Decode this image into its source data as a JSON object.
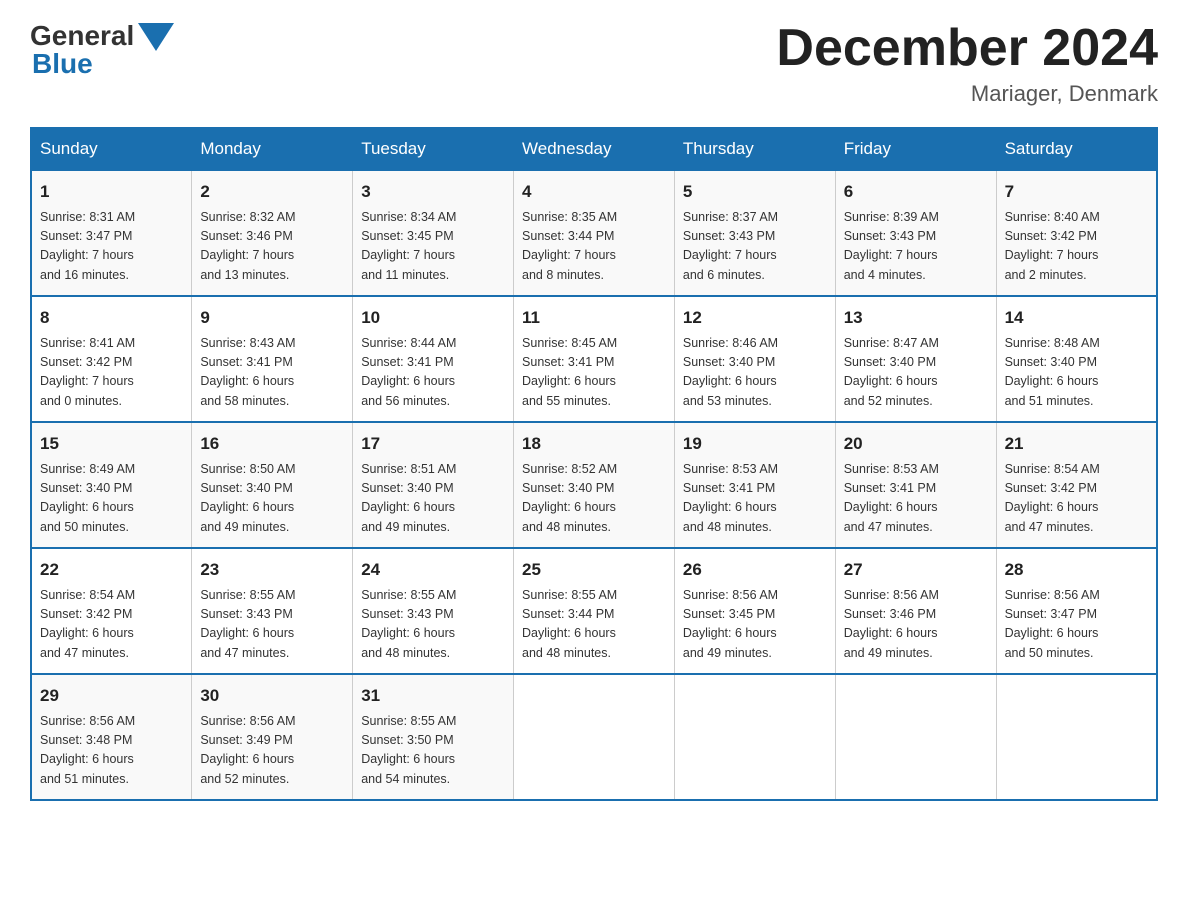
{
  "header": {
    "logo_general": "General",
    "logo_blue": "Blue",
    "month_title": "December 2024",
    "location": "Mariager, Denmark"
  },
  "days_of_week": [
    "Sunday",
    "Monday",
    "Tuesday",
    "Wednesday",
    "Thursday",
    "Friday",
    "Saturday"
  ],
  "weeks": [
    [
      {
        "day": "1",
        "sunrise": "8:31 AM",
        "sunset": "3:47 PM",
        "daylight": "7 hours and 16 minutes."
      },
      {
        "day": "2",
        "sunrise": "8:32 AM",
        "sunset": "3:46 PM",
        "daylight": "7 hours and 13 minutes."
      },
      {
        "day": "3",
        "sunrise": "8:34 AM",
        "sunset": "3:45 PM",
        "daylight": "7 hours and 11 minutes."
      },
      {
        "day": "4",
        "sunrise": "8:35 AM",
        "sunset": "3:44 PM",
        "daylight": "7 hours and 8 minutes."
      },
      {
        "day": "5",
        "sunrise": "8:37 AM",
        "sunset": "3:43 PM",
        "daylight": "7 hours and 6 minutes."
      },
      {
        "day": "6",
        "sunrise": "8:39 AM",
        "sunset": "3:43 PM",
        "daylight": "7 hours and 4 minutes."
      },
      {
        "day": "7",
        "sunrise": "8:40 AM",
        "sunset": "3:42 PM",
        "daylight": "7 hours and 2 minutes."
      }
    ],
    [
      {
        "day": "8",
        "sunrise": "8:41 AM",
        "sunset": "3:42 PM",
        "daylight": "7 hours and 0 minutes."
      },
      {
        "day": "9",
        "sunrise": "8:43 AM",
        "sunset": "3:41 PM",
        "daylight": "6 hours and 58 minutes."
      },
      {
        "day": "10",
        "sunrise": "8:44 AM",
        "sunset": "3:41 PM",
        "daylight": "6 hours and 56 minutes."
      },
      {
        "day": "11",
        "sunrise": "8:45 AM",
        "sunset": "3:41 PM",
        "daylight": "6 hours and 55 minutes."
      },
      {
        "day": "12",
        "sunrise": "8:46 AM",
        "sunset": "3:40 PM",
        "daylight": "6 hours and 53 minutes."
      },
      {
        "day": "13",
        "sunrise": "8:47 AM",
        "sunset": "3:40 PM",
        "daylight": "6 hours and 52 minutes."
      },
      {
        "day": "14",
        "sunrise": "8:48 AM",
        "sunset": "3:40 PM",
        "daylight": "6 hours and 51 minutes."
      }
    ],
    [
      {
        "day": "15",
        "sunrise": "8:49 AM",
        "sunset": "3:40 PM",
        "daylight": "6 hours and 50 minutes."
      },
      {
        "day": "16",
        "sunrise": "8:50 AM",
        "sunset": "3:40 PM",
        "daylight": "6 hours and 49 minutes."
      },
      {
        "day": "17",
        "sunrise": "8:51 AM",
        "sunset": "3:40 PM",
        "daylight": "6 hours and 49 minutes."
      },
      {
        "day": "18",
        "sunrise": "8:52 AM",
        "sunset": "3:40 PM",
        "daylight": "6 hours and 48 minutes."
      },
      {
        "day": "19",
        "sunrise": "8:53 AM",
        "sunset": "3:41 PM",
        "daylight": "6 hours and 48 minutes."
      },
      {
        "day": "20",
        "sunrise": "8:53 AM",
        "sunset": "3:41 PM",
        "daylight": "6 hours and 47 minutes."
      },
      {
        "day": "21",
        "sunrise": "8:54 AM",
        "sunset": "3:42 PM",
        "daylight": "6 hours and 47 minutes."
      }
    ],
    [
      {
        "day": "22",
        "sunrise": "8:54 AM",
        "sunset": "3:42 PM",
        "daylight": "6 hours and 47 minutes."
      },
      {
        "day": "23",
        "sunrise": "8:55 AM",
        "sunset": "3:43 PM",
        "daylight": "6 hours and 47 minutes."
      },
      {
        "day": "24",
        "sunrise": "8:55 AM",
        "sunset": "3:43 PM",
        "daylight": "6 hours and 48 minutes."
      },
      {
        "day": "25",
        "sunrise": "8:55 AM",
        "sunset": "3:44 PM",
        "daylight": "6 hours and 48 minutes."
      },
      {
        "day": "26",
        "sunrise": "8:56 AM",
        "sunset": "3:45 PM",
        "daylight": "6 hours and 49 minutes."
      },
      {
        "day": "27",
        "sunrise": "8:56 AM",
        "sunset": "3:46 PM",
        "daylight": "6 hours and 49 minutes."
      },
      {
        "day": "28",
        "sunrise": "8:56 AM",
        "sunset": "3:47 PM",
        "daylight": "6 hours and 50 minutes."
      }
    ],
    [
      {
        "day": "29",
        "sunrise": "8:56 AM",
        "sunset": "3:48 PM",
        "daylight": "6 hours and 51 minutes."
      },
      {
        "day": "30",
        "sunrise": "8:56 AM",
        "sunset": "3:49 PM",
        "daylight": "6 hours and 52 minutes."
      },
      {
        "day": "31",
        "sunrise": "8:55 AM",
        "sunset": "3:50 PM",
        "daylight": "6 hours and 54 minutes."
      },
      null,
      null,
      null,
      null
    ]
  ],
  "labels": {
    "sunrise": "Sunrise:",
    "sunset": "Sunset:",
    "daylight": "Daylight:"
  }
}
